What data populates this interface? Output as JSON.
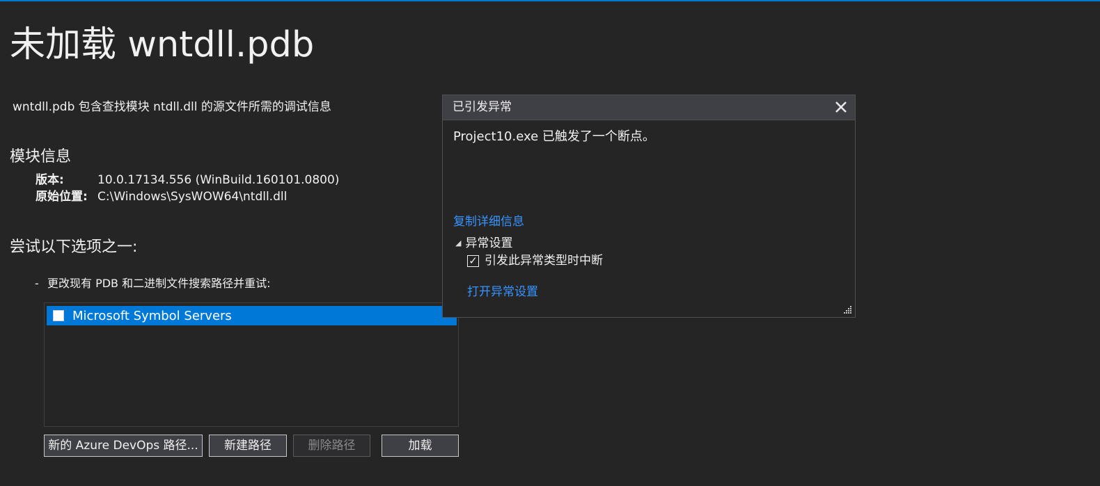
{
  "page": {
    "title": "未加载 wntdll.pdb",
    "description": "wntdll.pdb 包含查找模块 ntdll.dll 的源文件所需的调试信息"
  },
  "module_info": {
    "heading": "模块信息",
    "version_label": "版本:",
    "version_value": "10.0.17134.556 (WinBuild.160101.0800)",
    "location_label": "原始位置:",
    "location_value": "C:\\Windows\\SysWOW64\\ntdll.dll"
  },
  "options": {
    "heading": "尝试以下选项之一:",
    "dash": "-",
    "item_text": "更改现有 PDB 和二进制文件搜索路径并重试:"
  },
  "symbol_list": {
    "items": [
      {
        "label": "Microsoft Symbol Servers",
        "checked": false,
        "selected": true
      }
    ]
  },
  "buttons": {
    "azure": "新的 Azure DevOps 路径...",
    "new_path": "新建路径",
    "delete_path": "删除路径",
    "load": "加载"
  },
  "exception_popup": {
    "title": "已引发异常",
    "message": "Project10.exe 已触发了一个断点。",
    "copy_details": "复制详细信息",
    "section_label": "异常设置",
    "checkbox_label": "引发此异常类型时中断",
    "checkbox_checked": true,
    "checkmark": "✓",
    "triangle": "◢",
    "open_settings": "打开异常设置"
  },
  "colors": {
    "background": "#252526",
    "accent": "#007acc",
    "selection": "#0078d7",
    "link": "#3794ff",
    "popup_header": "#3f3f46"
  },
  "icons": {
    "close": "close-icon",
    "collapse": "triangle-expanded-icon",
    "grip": "resize-grip-icon"
  }
}
